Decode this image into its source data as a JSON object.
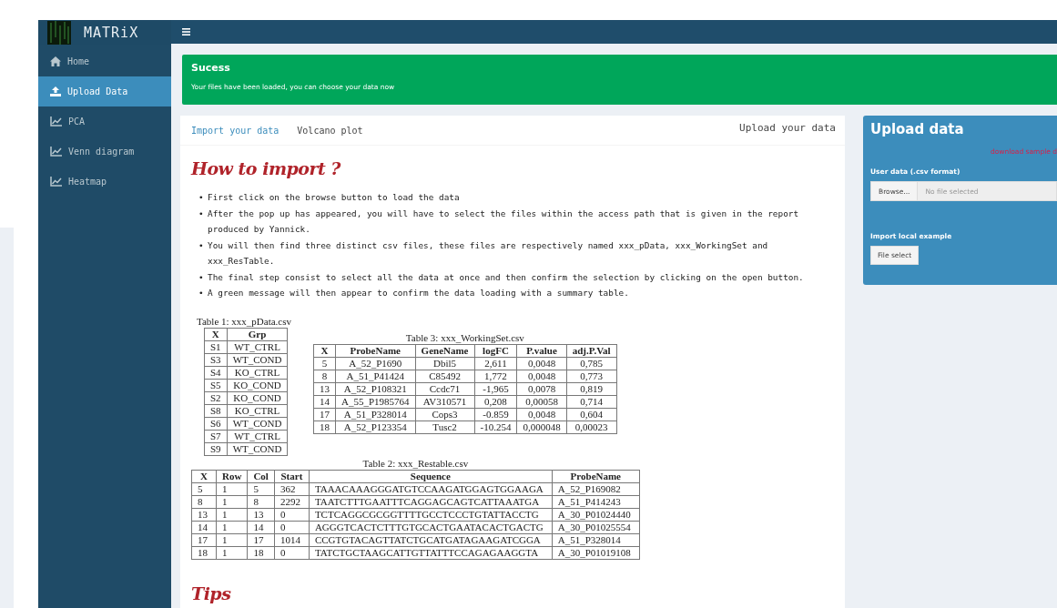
{
  "app": {
    "logo_text": "MATRiX"
  },
  "sidebar": {
    "items": [
      {
        "label": "Home",
        "kind": "home",
        "selected": false
      },
      {
        "label": "Upload Data",
        "kind": "upload",
        "selected": true
      },
      {
        "label": "PCA",
        "kind": "chart",
        "selected": false
      },
      {
        "label": "Venn diagram",
        "kind": "chart",
        "selected": false
      },
      {
        "label": "Heatmap",
        "kind": "chart",
        "selected": false
      }
    ]
  },
  "alert": {
    "title": "Sucess",
    "message": "Your files have been loaded, you can choose your data now"
  },
  "tab_box": {
    "tabs": [
      {
        "label": "Import your data",
        "selected": true
      },
      {
        "label": "Volcano plot",
        "selected": false
      }
    ],
    "title": "Upload your data",
    "heading": "How to import ?",
    "bullets": [
      {
        "marker": "•",
        "text": "First click on the browse button to load the data"
      },
      {
        "marker": "•",
        "text": "After the pop up has appeared, you will have to select the files within the access path that is given in the report produced by Yannick."
      },
      {
        "marker": "•",
        "text": "You will then find three distinct csv files, these files are respectively named xxx_pData, xxx_WorkingSet and xxx_ResTable."
      },
      {
        "marker": "•",
        "text": "The final step consist to select all the data at once and then confirm the selection by clicking on the open button."
      },
      {
        "marker": "•",
        "text": "A green message will then appear to confirm the data loading with a summary table."
      }
    ],
    "table_groups": [
      {
        "tables": [
          {
            "caption": "Table 1: xxx_pData.csv",
            "columns": [
              "X",
              "Grp"
            ],
            "rows": [
              [
                "S1",
                "WT_CTRL"
              ],
              [
                "S3",
                "WT_COND"
              ],
              [
                "S4",
                "KO_CTRL"
              ],
              [
                "S5",
                "KO_COND"
              ],
              [
                "S2",
                "KO_COND"
              ],
              [
                "S8",
                "KO_CTRL"
              ],
              [
                "S6",
                "WT_COND"
              ],
              [
                "S7",
                "WT_CTRL"
              ],
              [
                "S9",
                "WT_COND"
              ]
            ]
          },
          {
            "caption": "Table 3: xxx_WorkingSet.csv",
            "columns": [
              "X",
              "ProbeName",
              "GeneName",
              "logFC",
              "P.value",
              "adj.P.Val"
            ],
            "rows": [
              [
                "5",
                "A_52_P1690",
                "Dbil5",
                "2,611",
                "0,0048",
                "0,785"
              ],
              [
                "8",
                "A_51_P41424",
                "C85492",
                "1,772",
                "0,0048",
                "0,773"
              ],
              [
                "13",
                "A_52_P108321",
                "Ccdc71",
                "-1,965",
                "0,0078",
                "0,819"
              ],
              [
                "14",
                "A_55_P1985764",
                "AV310571",
                "0,208",
                "0,00058",
                "0,714"
              ],
              [
                "17",
                "A_51_P328014",
                "Cops3",
                "-0.859",
                "0,0048",
                "0,604"
              ],
              [
                "18",
                "A_52_P123354",
                "Tusc2",
                "-10.254",
                "0,000048",
                "0,00023"
              ]
            ]
          }
        ]
      },
      {
        "tables": [
          {
            "caption": "Table 2: xxx_Restable.csv",
            "columns": [
              "X",
              "Row",
              "Col",
              "Start",
              "Sequence",
              "ProbeName"
            ],
            "rows": [
              [
                "5",
                "1",
                "5",
                "362",
                "TAAACAAAGGGATGTCCAAGATGGAGTGGAAGA",
                "A_52_P169082"
              ],
              [
                "8",
                "1",
                "8",
                "2292",
                "TAATCTTTGAATTTCAGGAGCAGTCATTAAATGA",
                "A_51_P414243"
              ],
              [
                "13",
                "1",
                "13",
                "0",
                "TCTCAGGCGCGGTTTTGCCTCCCTGTATTACCTG",
                "A_30_P01024440"
              ],
              [
                "14",
                "1",
                "14",
                "0",
                "AGGGTCACTCTTTGTGCACTGAATACACTGACTG",
                "A_30_P01025554"
              ],
              [
                "17",
                "1",
                "17",
                "1014",
                "CCGTGTACAGTTATCTGCATGATAGAAGATCGGA",
                "A_51_P328014"
              ],
              [
                "18",
                "1",
                "18",
                "0",
                "TATCTGCTAAGCATTGTTATTTCCAGAGAAGGTA",
                "A_30_P01019108"
              ]
            ]
          }
        ]
      }
    ],
    "tips_heading": "Tips"
  },
  "upload_box": {
    "title": "Upload data",
    "download_link": "download sample d",
    "user_data_label": "User data (.csv format)",
    "browse_button": "Browse...",
    "file_placeholder": "No file selected",
    "local_label": "Import local example",
    "file_select_button": "File select"
  }
}
